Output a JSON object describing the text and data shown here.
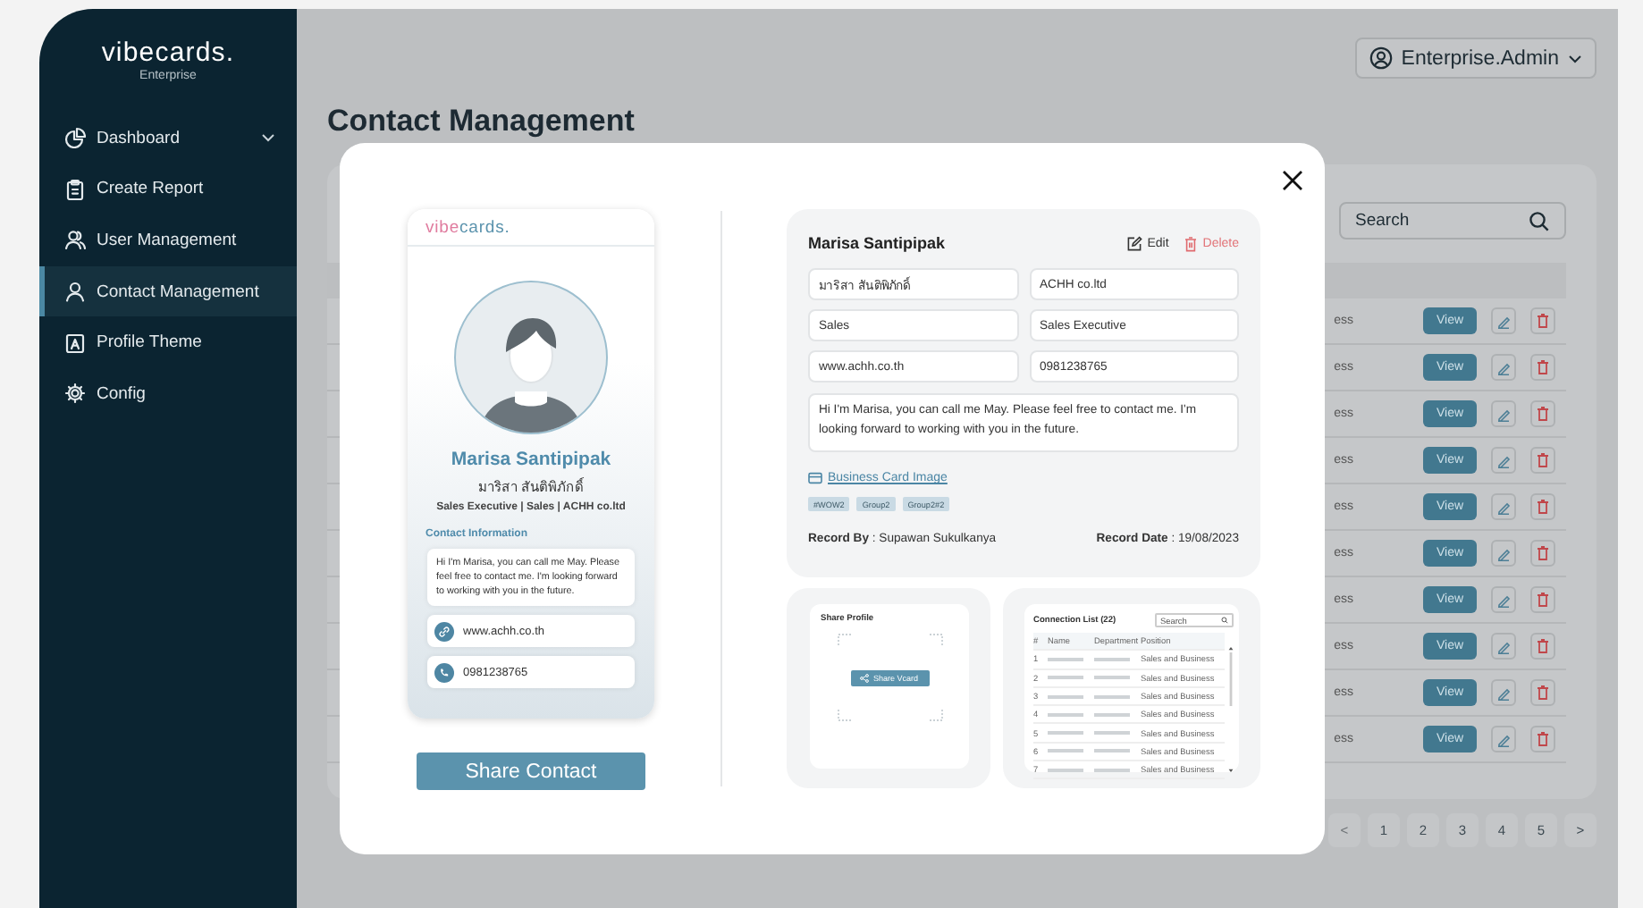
{
  "sidebar": {
    "logo": "vibecards.",
    "subtitle": "Enterprise",
    "items": [
      {
        "label": "Dashboard",
        "expandable": true,
        "selected": false
      },
      {
        "label": "Create Report",
        "expandable": false,
        "selected": false
      },
      {
        "label": "User Management",
        "expandable": false,
        "selected": false
      },
      {
        "label": "Contact Management",
        "expandable": false,
        "selected": true
      },
      {
        "label": "Profile Theme",
        "expandable": false,
        "selected": false
      },
      {
        "label": "Config",
        "expandable": false,
        "selected": false
      }
    ]
  },
  "header": {
    "user": "Enterprise.Admin"
  },
  "page_title": "Contact Management",
  "table": {
    "search_placeholder": "Search",
    "rows": [
      {
        "column_3": "ess",
        "action": "View"
      },
      {
        "column_3": "ess",
        "action": "View"
      },
      {
        "column_3": "ess",
        "action": "View"
      },
      {
        "column_3": "ess",
        "action": "View"
      },
      {
        "column_3": "ess",
        "action": "View"
      },
      {
        "column_3": "ess",
        "action": "View"
      },
      {
        "column_3": "ess",
        "action": "View"
      },
      {
        "column_3": "ess",
        "action": "View"
      },
      {
        "column_3": "ess",
        "action": "View"
      },
      {
        "column_3": "ess",
        "action": "View"
      }
    ]
  },
  "pagination": {
    "prev": {
      "label": "<",
      "disabled": true
    },
    "pages": [
      "1",
      "2",
      "3",
      "4",
      "5"
    ],
    "next": {
      "label": ">",
      "disabled": false
    }
  },
  "modal": {
    "card_preview": {
      "logo_parts": [
        "vibe",
        "cards."
      ],
      "name": "Marisa Santipipak",
      "thai_name": "มาริสา สันติพิภักดิ์",
      "headline": "Sales Executive | Sales | ACHH co.ltd",
      "section": "Contact Information",
      "about": "Hi I'm Marisa, you can call me May. Please feel free to contact me. I'm looking forward to working with you in the future.",
      "links": [
        {
          "kind": "web",
          "text": "www.achh.co.th"
        },
        {
          "kind": "phone",
          "text": "0981238765"
        }
      ]
    },
    "share_button": "Share Contact",
    "details": {
      "name": "Marisa Santipipak",
      "edit": "Edit",
      "delete": "Delete",
      "fields": [
        "มาริสา สันติพิภักดิ์",
        "ACHH co.ltd",
        "Sales",
        "Sales Executive",
        "www.achh.co.th",
        "0981238765"
      ],
      "about": "Hi I'm Marisa, you can call me May. Please feel free to contact me. I'm looking forward to working with you in the future.",
      "business_card_link": "Business Card Image",
      "tags": [
        "#WOW2",
        "Group2",
        "Group2#2"
      ],
      "record_by": "**Record By** : Supawan Sukulkanya",
      "record_date": "**Record Date** : 19/08/2023"
    },
    "share_preview": {
      "title": "Share Profile",
      "button": "Share Vcard"
    },
    "connections_preview": {
      "title": "Connection List (22)",
      "search_placeholder": "Search",
      "columns": [
        "#",
        "Name",
        "Department",
        "Position"
      ],
      "rows": [
        {
          "number": "1",
          "position": "Sales and Business"
        },
        {
          "number": "2",
          "position": "Sales and Business"
        },
        {
          "number": "3",
          "position": "Sales and Business"
        },
        {
          "number": "4",
          "position": "Sales and Business"
        },
        {
          "number": "5",
          "position": "Sales and Business"
        },
        {
          "number": "6",
          "position": "Sales and Business"
        },
        {
          "number": "7",
          "position": "Sales and Business"
        }
      ]
    }
  }
}
